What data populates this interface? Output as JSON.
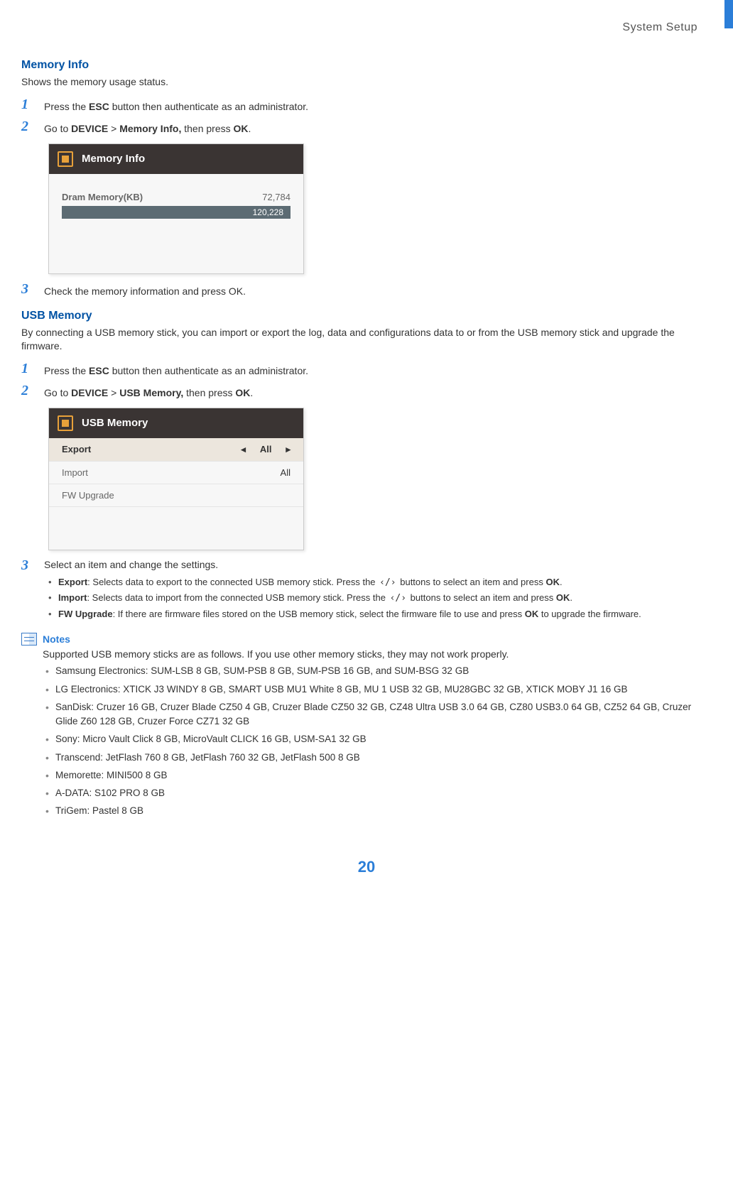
{
  "header": {
    "chapter": "System  Setup"
  },
  "memory": {
    "heading": "Memory Info",
    "desc": "Shows the memory usage status.",
    "steps": [
      {
        "num": "1",
        "segments": [
          {
            "t": "Press the "
          },
          {
            "t": "ESC",
            "b": true
          },
          {
            "t": " button then authenticate as an administrator."
          }
        ]
      },
      {
        "num": "2",
        "segments": [
          {
            "t": "Go to "
          },
          {
            "t": "DEVICE",
            "b": true
          },
          {
            "t": " > "
          },
          {
            "t": "Memory Info,",
            "b": true
          },
          {
            "t": " then press "
          },
          {
            "t": "OK",
            "b": true
          },
          {
            "t": "."
          }
        ]
      },
      {
        "num": "3",
        "segments": [
          {
            "t": "Check the memory information and press OK."
          }
        ]
      }
    ],
    "shot": {
      "title": "Memory Info",
      "row_label": "Dram Memory(KB)",
      "row_value": "72,784",
      "bar_value": "120,228"
    }
  },
  "usb": {
    "heading": "USB Memory",
    "desc": "By connecting a USB memory stick, you can import or export the log, data and configurations data to or from the USB memory stick and upgrade the firmware.",
    "steps": [
      {
        "num": "1",
        "segments": [
          {
            "t": "Press the "
          },
          {
            "t": "ESC",
            "b": true
          },
          {
            "t": " button then authenticate as an administrator."
          }
        ]
      },
      {
        "num": "2",
        "segments": [
          {
            "t": "Go to "
          },
          {
            "t": "DEVICE",
            "b": true
          },
          {
            "t": " > "
          },
          {
            "t": "USB Memory,",
            "b": true
          },
          {
            "t": " then press "
          },
          {
            "t": "OK",
            "b": true
          },
          {
            "t": "."
          }
        ]
      },
      {
        "num": "3",
        "segments": [
          {
            "t": "Select an item and change the settings."
          }
        ],
        "bullets": [
          {
            "segments": [
              {
                "t": "Export",
                "b": true
              },
              {
                "t": ": Selects data to export to the connected USB memory stick. Press the  "
              },
              {
                "t": "‹/›",
                "angle": true
              },
              {
                "t": "  buttons to select an item and press "
              },
              {
                "t": "OK",
                "b": true
              },
              {
                "t": "."
              }
            ]
          },
          {
            "segments": [
              {
                "t": "Import",
                "b": true
              },
              {
                "t": ": Selects data to import from the connected USB memory stick. Press the  "
              },
              {
                "t": "‹/›",
                "angle": true
              },
              {
                "t": "  buttons to select an item and press "
              },
              {
                "t": "OK",
                "b": true
              },
              {
                "t": "."
              }
            ]
          },
          {
            "segments": [
              {
                "t": "FW Upgrade",
                "b": true
              },
              {
                "t": ": If there are firmware files stored on the USB memory stick, select the firmware file to use and press "
              },
              {
                "t": "OK",
                "b": true
              },
              {
                "t": " to upgrade the firmware."
              }
            ]
          }
        ]
      }
    ],
    "shot": {
      "title": "USB Memory",
      "rows": [
        {
          "label": "Export",
          "value": "All",
          "arrows": true,
          "selected": true
        },
        {
          "label": "Import",
          "value": "All",
          "arrows": false,
          "selected": false
        },
        {
          "label": "FW Upgrade",
          "value": "",
          "arrows": false,
          "selected": false
        }
      ]
    }
  },
  "notes": {
    "title": "Notes",
    "intro": "Supported USB memory sticks are as follows. If you use other memory sticks, they may not work properly.",
    "items": [
      "Samsung Electronics: SUM-LSB 8 GB, SUM-PSB 8 GB, SUM-PSB 16 GB, and SUM-BSG 32 GB",
      "LG Electronics: XTICK J3 WINDY 8 GB, SMART USB MU1 White 8 GB, MU 1 USB 32 GB, MU28GBC 32 GB, XTICK MOBY J1 16 GB",
      "SanDisk: Cruzer 16 GB, Cruzer Blade CZ50 4 GB, Cruzer Blade CZ50 32 GB, CZ48 Ultra USB 3.0 64 GB, CZ80 USB3.0 64 GB, CZ52 64 GB, Cruzer Glide Z60 128 GB, Cruzer Force CZ71 32 GB",
      "Sony: Micro Vault Click 8 GB, MicroVault CLICK 16 GB, USM-SA1 32 GB",
      "Transcend: JetFlash 760 8 GB, JetFlash 760 32 GB, JetFlash 500 8 GB",
      "Memorette: MINI500 8 GB",
      "A-DATA: S102 PRO 8 GB",
      "TriGem: Pastel 8 GB"
    ]
  },
  "page_number": "20",
  "glyphs": {
    "left": "◂",
    "right": "▸"
  }
}
